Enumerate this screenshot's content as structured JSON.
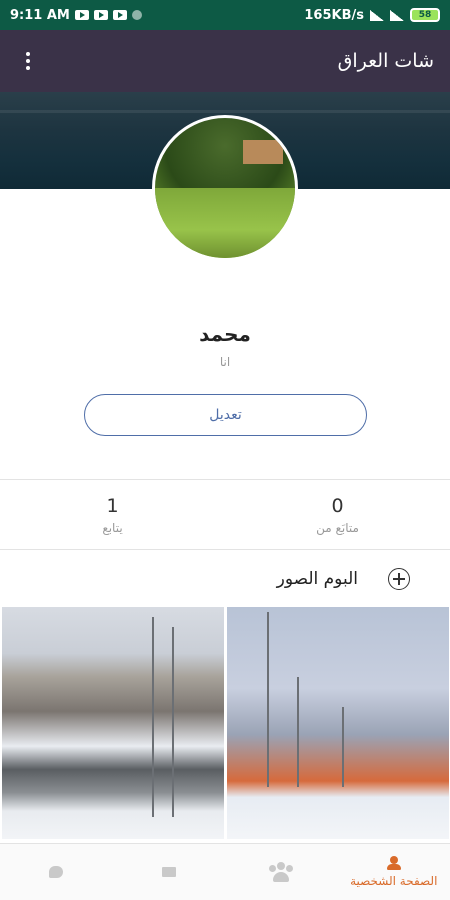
{
  "status_bar": {
    "time": "9:11 AM",
    "network_speed": "165KB/s",
    "battery": "58"
  },
  "app_bar": {
    "title": "شات العراق",
    "menu_icon": "more-vert-icon"
  },
  "profile": {
    "name": "محمد",
    "status": "انا",
    "edit_label": "تعديل"
  },
  "stats": {
    "following_count": "1",
    "following_label": "يتابع",
    "followers_count": "0",
    "followers_label": "متابَع من"
  },
  "album": {
    "title": "البوم الصور",
    "add_icon": "add-circle-icon"
  },
  "bottom_nav": {
    "items": [
      {
        "icon": "chat-icon",
        "label": ""
      },
      {
        "icon": "mail-icon",
        "label": ""
      },
      {
        "icon": "group-icon",
        "label": ""
      },
      {
        "icon": "person-icon",
        "label": "الصفحة الشخصية"
      }
    ],
    "active_color": "#d96b2a"
  },
  "colors": {
    "status_bar": "#0d5a45",
    "app_bar": "#3a3248",
    "accent_button": "#4f6ea8"
  }
}
